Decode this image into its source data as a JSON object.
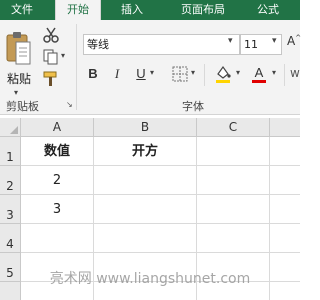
{
  "ribbon_tabs": [
    "文件",
    "开始",
    "插入",
    "页面布局",
    "公式"
  ],
  "active_tab": "开始",
  "clipboard": {
    "paste_label": "粘贴",
    "group_label": "剪贴板"
  },
  "font": {
    "name": "等线",
    "size": "11",
    "bold": "B",
    "italic": "I",
    "underline": "U",
    "group_label": "字体",
    "fill_color": "#ffd400",
    "font_color": "#e00000"
  },
  "sheet": {
    "columns": [
      "A",
      "B",
      "C"
    ],
    "rows": [
      "1",
      "2",
      "3",
      "4",
      "5"
    ],
    "cells": [
      [
        "数值",
        "开方",
        ""
      ],
      [
        "2",
        "",
        ""
      ],
      [
        "3",
        "",
        ""
      ],
      [
        "",
        "",
        ""
      ],
      [
        "",
        "",
        ""
      ]
    ]
  },
  "watermark": "亮术网 www.liangshunet.com",
  "colors": {
    "brand": "#217346"
  }
}
